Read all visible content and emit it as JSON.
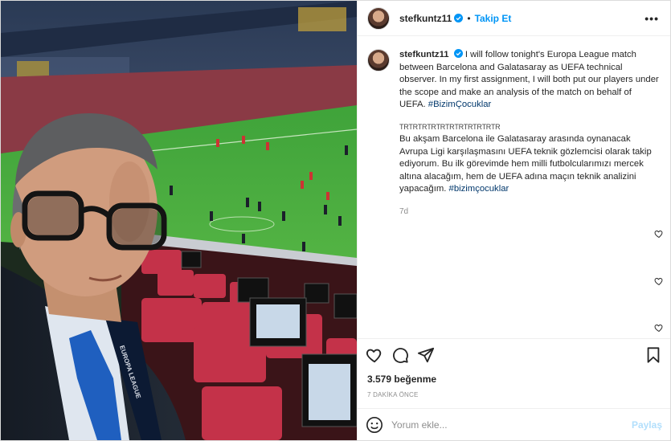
{
  "header": {
    "username": "stefkuntz11",
    "separator": "•",
    "follow_label": "Takip Et",
    "more_label": "•••"
  },
  "caption": {
    "username": "stefkuntz11",
    "text_en": "I will follow tonight's Europa League match between Barcelona and Galatasaray as UEFA technical observer. In my first assignment, I will both put our players under the scope and make an analysis of the match on behalf of UEFA.",
    "hashtag_en": "#BizimÇocuklar",
    "tick_line": "ΤRΤRΤRΤRΤRΤRΤRΤRΤRΤRΤR",
    "text_tr": "Bu akşam Barcelona ile Galatasaray arasında oynanacak Avrupa Ligi karşılaşmasını UEFA teknik gözlemcisi olarak takip ediyorum. Bu ilk görevimde hem milli futbolcularımızı mercek altına alacağım, hem de UEFA adına maçın teknik analizini yapacağım.",
    "hashtag_tr": "#bizimçocuklar",
    "time": "7d"
  },
  "actions": {
    "icons": [
      "heart-icon",
      "comment-icon",
      "share-icon",
      "bookmark-icon"
    ]
  },
  "likes_text": "3.579 beğenme",
  "posted_ago": "7 DAKİKA ÖNCE",
  "comment_box": {
    "placeholder": "Yorum ekle...",
    "post_label": "Paylaş"
  },
  "photo": {
    "lanyard_text": "EUROPA LEAGUE"
  },
  "colors": {
    "accent": "#0095f6",
    "hashtag": "#00376b",
    "muted": "#8e8e8e",
    "post_disabled": "#b2dffc"
  }
}
